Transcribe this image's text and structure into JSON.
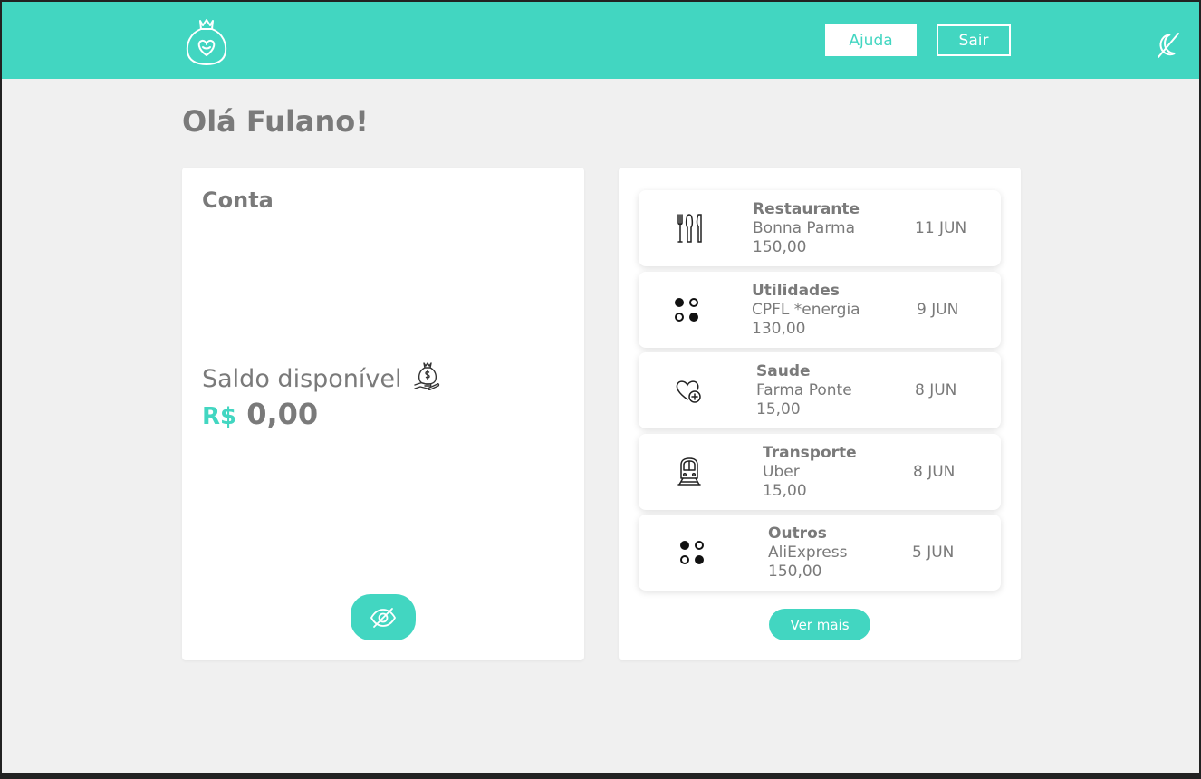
{
  "header": {
    "help_label": "Ajuda",
    "logout_label": "Sair",
    "brand_color": "#42d6c1"
  },
  "greeting": "Olá Fulano!",
  "account": {
    "title": "Conta",
    "balance_label": "Saldo disponível",
    "currency": "R$",
    "amount": "0,00"
  },
  "transactions": [
    {
      "category": "Restaurante",
      "merchant": "Bonna Parma",
      "value": "150,00",
      "date": "11 JUN",
      "icon": "cutlery-icon"
    },
    {
      "category": "Utilidades",
      "merchant": "CPFL *energia",
      "value": "130,00",
      "date": "9 JUN",
      "icon": "utilities-icon"
    },
    {
      "category": "Saude",
      "merchant": "Farma Ponte",
      "value": "15,00",
      "date": "8 JUN",
      "icon": "health-icon"
    },
    {
      "category": "Transporte",
      "merchant": "Uber",
      "value": "15,00",
      "date": "8 JUN",
      "icon": "train-icon"
    },
    {
      "category": "Outros",
      "merchant": "AliExpress",
      "value": "150,00",
      "date": "5 JUN",
      "icon": "dots-icon"
    }
  ],
  "see_more_label": "Ver mais"
}
